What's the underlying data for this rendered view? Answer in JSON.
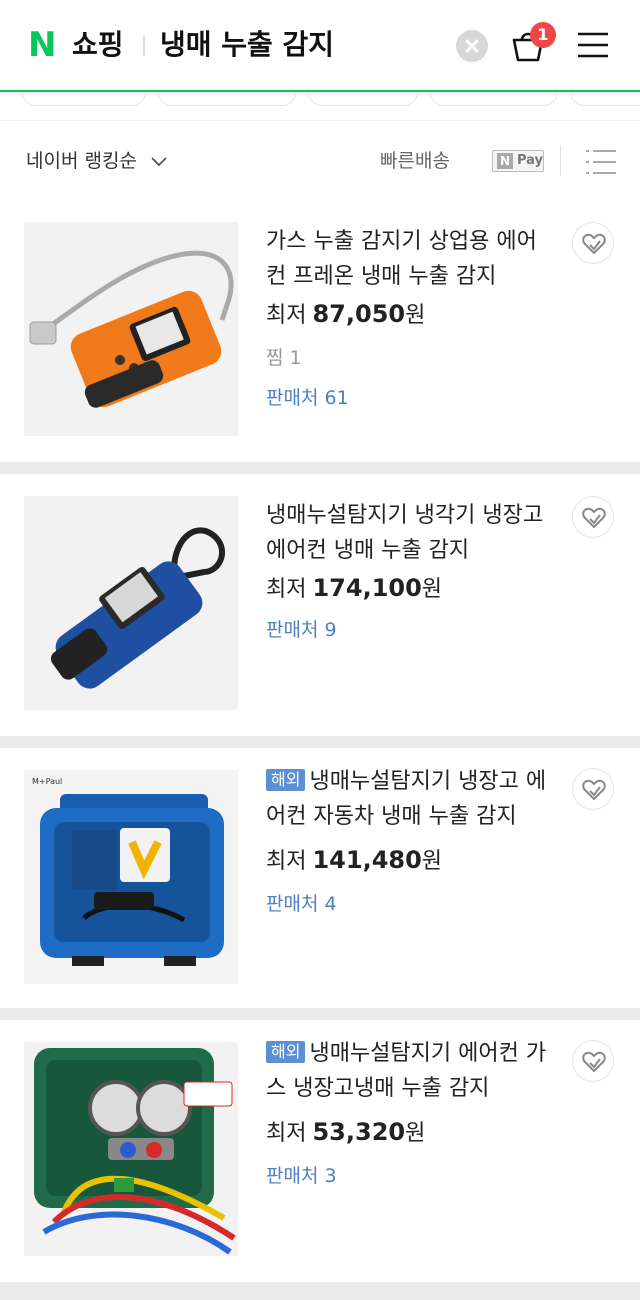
{
  "header": {
    "logo_letter": "N",
    "brand": "쇼핑",
    "query": "냉매 누출 감지",
    "cart_count": "1"
  },
  "sort": {
    "label": "네이버 랭킹순",
    "fast_delivery": "빠른배송",
    "npay_n": "N",
    "npay_pay": "Pay"
  },
  "products": [
    {
      "title": "가스 누출 감지기 상업용 에어컨 프레온 냉매 누출 감지",
      "overseas": false,
      "price_prefix": "최저",
      "price": "87,050",
      "unit": "원",
      "zzim": "찜 1",
      "sellers": "판매처 61"
    },
    {
      "title": "냉매누설탐지기 냉각기 냉장고 에어컨 냉매 누출 감지",
      "overseas": false,
      "price_prefix": "최저",
      "price": "174,100",
      "unit": "원",
      "sellers": "판매처 9"
    },
    {
      "title": "냉매누설탐지기 냉장고 에어컨 자동차 냉매 누출 감지",
      "overseas": true,
      "overseas_label": "해외",
      "image_text": "M+Paul",
      "price_prefix": "최저",
      "price": "141,480",
      "unit": "원",
      "sellers": "판매처 4"
    },
    {
      "title": "냉매누설탐지기 에어컨 가스 냉장고냉매 누출 감지",
      "overseas": true,
      "overseas_label": "해외",
      "price_prefix": "최저",
      "price": "53,320",
      "unit": "원",
      "sellers": "판매처 3"
    }
  ],
  "colors": {
    "naver_green": "#03c75a",
    "seller_blue": "#4f7fc0",
    "overseas_badge": "#5b8fd6",
    "cart_badge": "#f04646"
  },
  "icons": [
    "naver-n-icon",
    "clear-icon",
    "cart-icon",
    "menu-icon",
    "chevron-down-icon",
    "list-view-icon",
    "heart-icon"
  ]
}
